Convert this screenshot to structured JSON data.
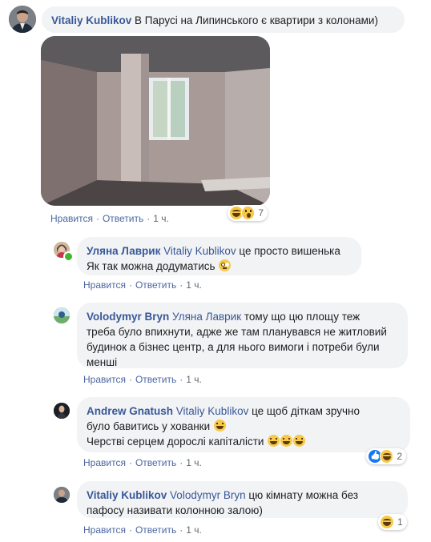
{
  "comments": [
    {
      "author": "Vitaliy Kublikov",
      "text": " В Парусі на Липинського є квартири з колонами)",
      "actions": {
        "like": "Нравится",
        "reply": "Ответить",
        "time": "1 ч."
      },
      "reaction_count": "7",
      "reaction_icons": [
        "haha-icon",
        "wow-icon"
      ]
    },
    {
      "author": "Уляна Лаврик",
      "mention": "Vitaliy Kublikov",
      "text_line1": " це просто вишенька",
      "text_line2": "Як так можна додуматись ",
      "actions": {
        "like": "Нравится",
        "reply": "Ответить",
        "time": "1 ч."
      }
    },
    {
      "author": "Volodymyr Bryn",
      "mention": "Уляна Лаврик",
      "text_line1": " тому що цю площу теж",
      "text_line2": "треба було впихнути, адже же там планувався не житловий",
      "text_line3": "будинок а бізнес центр, а для нього вимоги і потреби були",
      "text_line4": "менші",
      "actions": {
        "like": "Нравится",
        "reply": "Ответить",
        "time": "1 ч."
      }
    },
    {
      "author": "Andrew Gnatush",
      "mention": "Vitaliy Kublikov",
      "text_line1": " це щоб діткам зручно",
      "text_line2": "було бавитись у хованки ",
      "text_line3": "Черстві серцем дорослі капіталісти ",
      "actions": {
        "like": "Нравится",
        "reply": "Ответить",
        "time": "1 ч."
      },
      "reaction_count": "2",
      "reaction_icons": [
        "like-icon",
        "haha-icon"
      ]
    },
    {
      "author": "Vitaliy Kublikov",
      "mention": "Volodymyr Bryn",
      "text_line1": " цю кімнату можна без",
      "text_line2": "пафосу називати колонною залою)",
      "actions": {
        "like": "Нравится",
        "reply": "Ответить",
        "time": "1 ч."
      },
      "reaction_count": "1",
      "reaction_icons": [
        "haha-icon"
      ]
    }
  ],
  "separator": "·"
}
